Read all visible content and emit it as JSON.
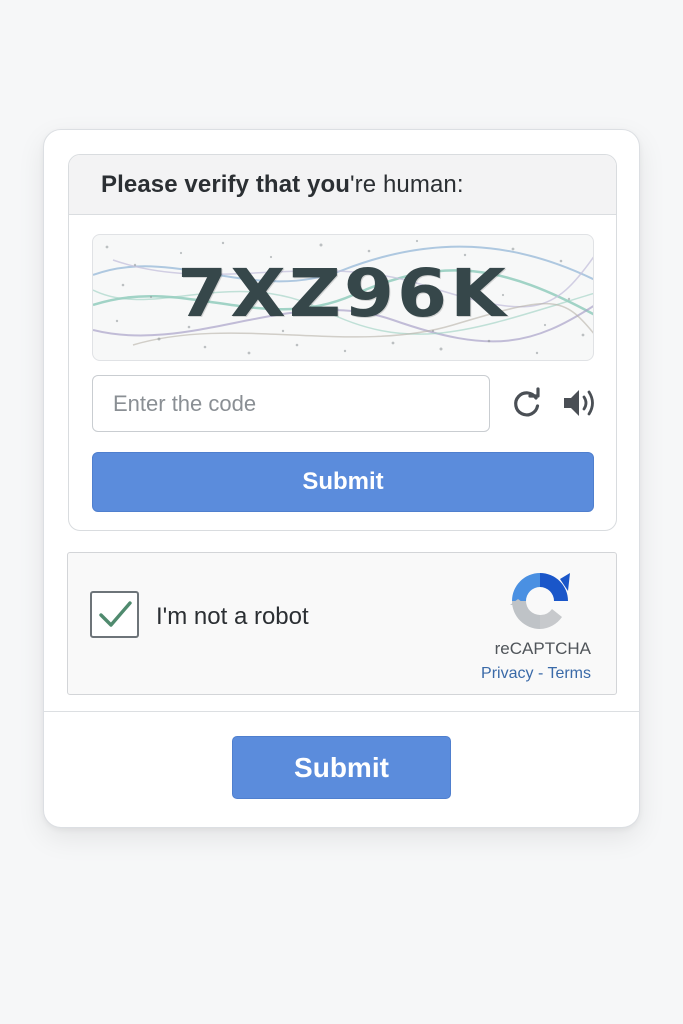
{
  "captcha": {
    "prompt_bold": "Please verify that you",
    "prompt_rest": "'re human:",
    "code": "7XZ96K",
    "input_placeholder": "Enter the code",
    "submit_label": "Submit",
    "refresh_icon": "refresh-icon",
    "audio_icon": "speaker-icon"
  },
  "recaptcha": {
    "checkbox_checked": true,
    "label": "I'm not a robot",
    "brand": "reCAPTCHA",
    "privacy": "Privacy",
    "separator": " - ",
    "terms": "Terms"
  },
  "form": {
    "submit_label": "Submit"
  },
  "colors": {
    "primary_button": "#5b8cdc",
    "checkmark": "#4f8a6e",
    "link": "#3a6aa8"
  }
}
